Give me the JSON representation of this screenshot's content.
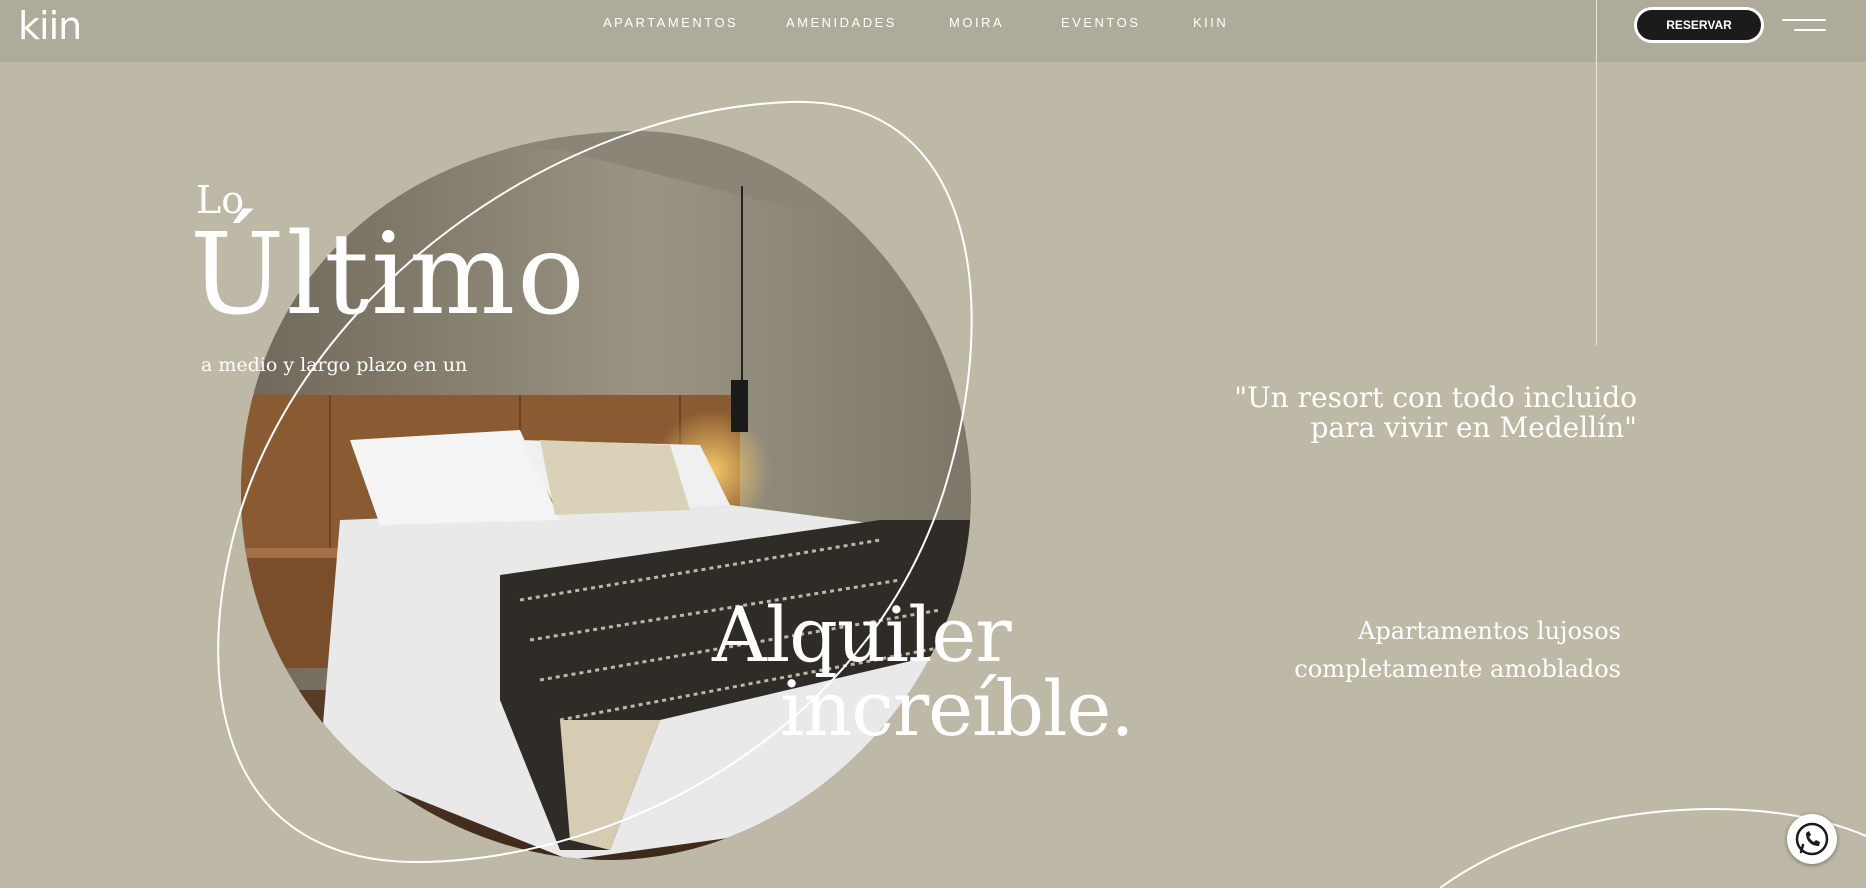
{
  "brand": {
    "logo_text": "kiin"
  },
  "nav": {
    "items": [
      "APARTAMENTOS",
      "AMENIDADES",
      "MOIRA",
      "EVENTOS",
      "KIIN"
    ],
    "reserve_label": "RESERVAR"
  },
  "hero": {
    "pre_title": "Lo",
    "title": "Último",
    "subtitle": "a medio y largo plazo en un",
    "headline_1": "Alquiler",
    "headline_2": "increíble.",
    "quote_line_1": "\"Un resort con todo incluido",
    "quote_line_2": "para vivir en Medellín\"",
    "feature_line_1": "Apartamentos lujosos",
    "feature_line_2": "completamente amoblados"
  },
  "icons": {
    "menu": "hamburger-menu-icon",
    "whatsapp": "whatsapp-icon"
  },
  "colors": {
    "background": "#bdb9a6",
    "header": "#aeab9b",
    "button": "#1b1b1b",
    "text": "#ffffff"
  }
}
